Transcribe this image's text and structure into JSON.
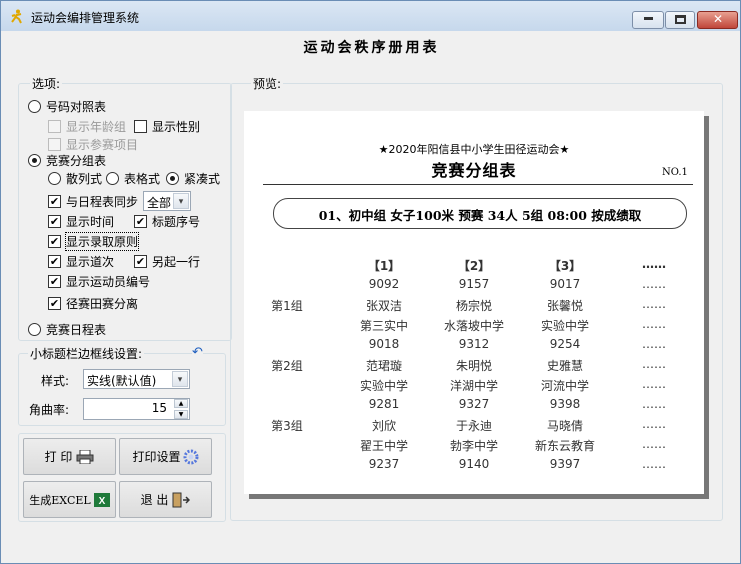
{
  "window": {
    "title": "运动会编排管理系统",
    "page_title": "运动会秩序册用表",
    "controls": {
      "minimize": "▬",
      "maximize": "□",
      "close": "✕"
    }
  },
  "options": {
    "legend": "选项:",
    "bib_table": "号码对照表",
    "show_age_group": "显示年龄组",
    "show_gender": "显示性别",
    "show_events": "显示参赛项目",
    "grouping_table": "竞赛分组表",
    "layout_scatter": "散列式",
    "layout_grid": "表格式",
    "layout_compact": "紧凑式",
    "sync_schedule": "与日程表同步",
    "sync_value": "全部",
    "show_time": "显示时间",
    "title_seq": "标题序号",
    "show_admission": "显示录取原则",
    "show_lane": "显示道次",
    "new_line": "另起一行",
    "show_athlete_no": "显示运动员编号",
    "field_event_split": "径赛田赛分离",
    "schedule_table": "竞赛日程表"
  },
  "subtitle_border": {
    "legend": "小标题栏边框线设置:",
    "style_label": "样式:",
    "style_value": "实线(默认值)",
    "radius_label": "角曲率:",
    "radius_value": "15"
  },
  "buttons": {
    "print": "打  印",
    "print_settings": "打印设置",
    "export_excel": "生成EXCEL",
    "exit": "退  出"
  },
  "preview": {
    "legend": "预览:",
    "meet_title": "★2020年阳信县中小学生田径运动会★",
    "table_title": "竞赛分组表",
    "page_no": "NO.1",
    "event_header": "01、初中组 女子100米 预赛 34人 5组 08:00 按成绩取",
    "lane_headers": [
      "【1】",
      "【2】",
      "【3】",
      "……"
    ],
    "rows": [
      {
        "group": "",
        "cells": [
          "9092",
          "9157",
          "9017",
          "……"
        ]
      },
      {
        "group": "第1组",
        "cells": [
          "张双洁",
          "杨宗悦",
          "张馨悦",
          "……"
        ]
      },
      {
        "group": "",
        "cells": [
          "第三实中",
          "水落坡中学",
          "实验中学",
          "……"
        ]
      },
      {
        "group": "",
        "cells": [
          "9018",
          "9312",
          "9254",
          "……"
        ]
      },
      {
        "group": "第2组",
        "cells": [
          "范珺璇",
          "朱明悦",
          "史雅慧",
          "……"
        ]
      },
      {
        "group": "",
        "cells": [
          "实验中学",
          "洋湖中学",
          "河流中学",
          "……"
        ]
      },
      {
        "group": "",
        "cells": [
          "9281",
          "9327",
          "9398",
          "……"
        ]
      },
      {
        "group": "第3组",
        "cells": [
          "刘欣",
          "于永迪",
          "马晓倩",
          "……"
        ]
      },
      {
        "group": "",
        "cells": [
          "翟王中学",
          "勃李中学",
          "新东云教育",
          "……"
        ]
      },
      {
        "group": "",
        "cells": [
          "9237",
          "9140",
          "9397",
          "……"
        ]
      }
    ]
  }
}
